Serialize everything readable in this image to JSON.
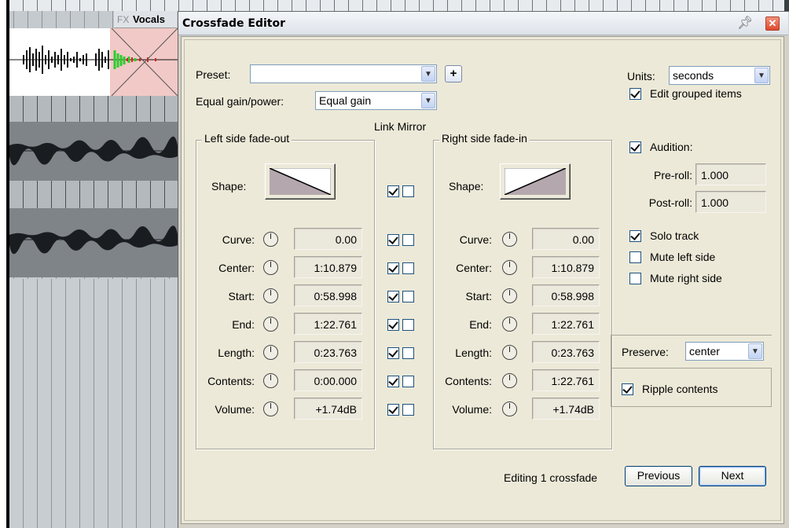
{
  "background": {
    "track_fx_label": "FX",
    "track_name": "Vocals"
  },
  "dialog": {
    "title": "Crossfade Editor",
    "preset_label": "Preset:",
    "preset_value": "",
    "add_preset": "+",
    "equal_gain_label": "Equal gain/power:",
    "equal_gain_value": "Equal gain",
    "link_mirror_label": "Link Mirror",
    "units_label": "Units:",
    "units_value": "seconds",
    "edit_grouped_label": "Edit grouped items",
    "edit_grouped_checked": true,
    "left": {
      "title": "Left side fade-out",
      "shape_label": "Shape:",
      "rows": [
        {
          "label": "Curve:",
          "value": "0.00"
        },
        {
          "label": "Center:",
          "value": "1:10.879"
        },
        {
          "label": "Start:",
          "value": "0:58.998"
        },
        {
          "label": "End:",
          "value": "1:22.761"
        },
        {
          "label": "Length:",
          "value": "0:23.763"
        },
        {
          "label": "Contents:",
          "value": "0:00.000"
        },
        {
          "label": "Volume:",
          "value": "+1.74dB"
        }
      ]
    },
    "right": {
      "title": "Right side fade-in",
      "shape_label": "Shape:",
      "rows": [
        {
          "label": "Curve:",
          "value": "0.00"
        },
        {
          "label": "Center:",
          "value": "1:10.879"
        },
        {
          "label": "Start:",
          "value": "0:58.998"
        },
        {
          "label": "End:",
          "value": "1:22.761"
        },
        {
          "label": "Length:",
          "value": "0:23.763"
        },
        {
          "label": "Contents:",
          "value": "1:22.761"
        },
        {
          "label": "Volume:",
          "value": "+1.74dB"
        }
      ]
    },
    "link_checks": [
      true,
      true,
      true,
      true,
      true,
      true,
      true,
      true
    ],
    "mirror_checks": [
      false,
      false,
      false,
      false,
      false,
      false,
      false,
      false
    ],
    "audition_label": "Audition:",
    "audition_checked": true,
    "preroll_label": "Pre-roll:",
    "preroll_value": "1.000",
    "postroll_label": "Post-roll:",
    "postroll_value": "1.000",
    "solo_label": "Solo track",
    "solo_checked": true,
    "mute_left_label": "Mute left side",
    "mute_left_checked": false,
    "mute_right_label": "Mute right side",
    "mute_right_checked": false,
    "preserve_label": "Preserve:",
    "preserve_value": "center",
    "ripple_label": "Ripple contents",
    "ripple_checked": true,
    "status_text": "Editing 1 crossfade",
    "previous_label": "Previous",
    "next_label": "Next"
  }
}
